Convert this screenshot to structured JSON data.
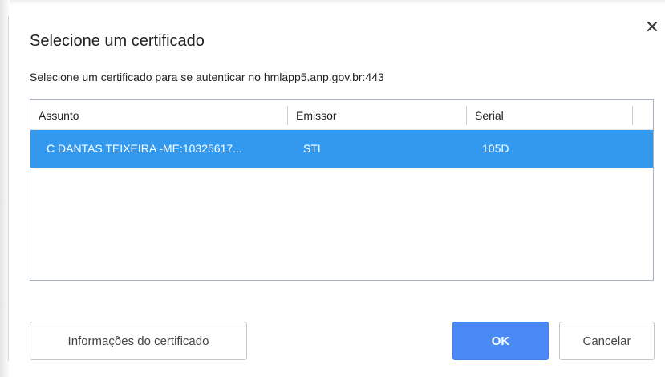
{
  "dialog": {
    "title": "Selecione um certificado",
    "subtitle": "Selecione um certificado para se autenticar no hmlapp5.anp.gov.br:443",
    "close_icon": "close-icon"
  },
  "table": {
    "columns": [
      "Assunto",
      "Emissor",
      "Serial"
    ],
    "rows": [
      {
        "subject": "C DANTAS TEIXEIRA -ME:10325617...",
        "issuer": "STI",
        "serial": "105D",
        "selected": true
      }
    ]
  },
  "buttons": {
    "info": "Informações do certificado",
    "ok": "OK",
    "cancel": "Cancelar"
  },
  "colors": {
    "selection": "#3399ef",
    "primary_button": "#4a8af5",
    "table_border": "#aab3c4"
  }
}
